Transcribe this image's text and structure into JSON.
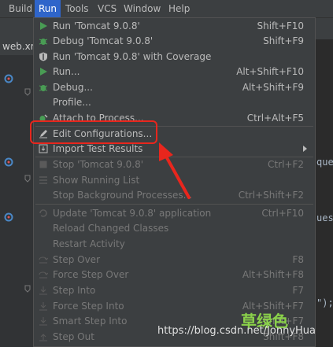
{
  "menubar": {
    "items": [
      "Build",
      "Run",
      "Tools",
      "VCS",
      "Window",
      "Help"
    ],
    "active": "Run"
  },
  "editor": {
    "tab_label": "web.xm",
    "snippet_1": "ques",
    "snippet_2": "uest",
    "snippet_3": "\");"
  },
  "menu": {
    "items": [
      {
        "label": "Run 'Tomcat 9.0.8'",
        "shortcut": "Shift+F10",
        "icon": "run-icon",
        "enabled": true
      },
      {
        "label": "Debug 'Tomcat 9.0.8'",
        "shortcut": "Shift+F9",
        "icon": "debug-icon",
        "enabled": true
      },
      {
        "label": "Run 'Tomcat 9.0.8' with Coverage",
        "shortcut": "",
        "icon": "coverage-icon",
        "enabled": true
      },
      {
        "label": "Run...",
        "shortcut": "Alt+Shift+F10",
        "icon": "run-icon",
        "enabled": true
      },
      {
        "label": "Debug...",
        "shortcut": "Alt+Shift+F9",
        "icon": "debug-icon",
        "enabled": true
      },
      {
        "label": "Profile...",
        "shortcut": "",
        "icon": "profile-icon",
        "enabled": true
      },
      {
        "label": "Attach to Process...",
        "shortcut": "Ctrl+Alt+F5",
        "icon": "attach-icon",
        "enabled": true
      },
      {
        "label": "Edit Configurations...",
        "shortcut": "",
        "icon": "edit-icon",
        "enabled": true
      },
      {
        "label": "Import Test Results",
        "shortcut": "",
        "icon": "import-icon",
        "enabled": true,
        "submenu": true
      },
      {
        "label": "Stop 'Tomcat 9.0.8'",
        "shortcut": "Ctrl+F2",
        "icon": "stop-icon",
        "enabled": false
      },
      {
        "label": "Show Running List",
        "shortcut": "",
        "icon": "list-icon",
        "enabled": false
      },
      {
        "label": "Stop Background Processes...",
        "shortcut": "Ctrl+Shift+F2",
        "icon": "",
        "enabled": false
      },
      {
        "label": "Update 'Tomcat 9.0.8' application",
        "shortcut": "Ctrl+F10",
        "icon": "update-icon",
        "enabled": false
      },
      {
        "label": "Reload Changed Classes",
        "shortcut": "",
        "icon": "",
        "enabled": false
      },
      {
        "label": "Restart Activity",
        "shortcut": "",
        "icon": "",
        "enabled": false
      },
      {
        "label": "Step Over",
        "shortcut": "F8",
        "icon": "step-over-icon",
        "enabled": false
      },
      {
        "label": "Force Step Over",
        "shortcut": "Alt+Shift+F8",
        "icon": "force-step-over-icon",
        "enabled": false
      },
      {
        "label": "Step Into",
        "shortcut": "F7",
        "icon": "step-into-icon",
        "enabled": false
      },
      {
        "label": "Force Step Into",
        "shortcut": "Alt+Shift+F7",
        "icon": "force-step-into-icon",
        "enabled": false
      },
      {
        "label": "Smart Step Into",
        "shortcut": "Shift+F7",
        "icon": "smart-step-into-icon",
        "enabled": false
      },
      {
        "label": "Step Out",
        "shortcut": "Shift+F8",
        "icon": "step-out-icon",
        "enabled": false
      }
    ]
  },
  "colors": {
    "menubar_bg": "#3c3f41",
    "active_bg": "#2f65ca",
    "annotation_red": "#e8261d",
    "run_green": "#499c54"
  },
  "watermark": {
    "url": "https://blog.csdn.net/JonnyHua",
    "cn": "草绿色"
  }
}
